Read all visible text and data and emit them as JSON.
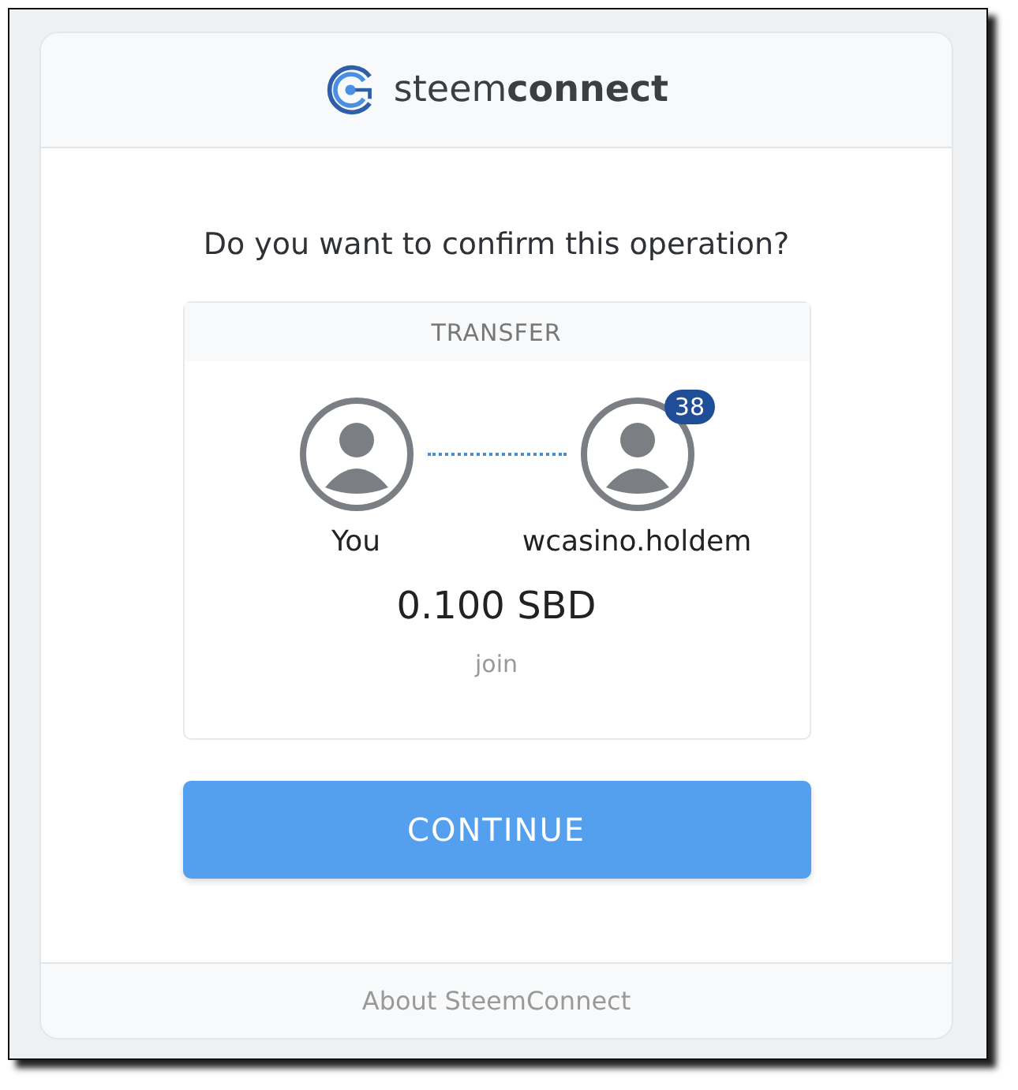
{
  "header": {
    "brand": "steem**connect**"
  },
  "question": "Do you want to confirm this operation?",
  "operation": {
    "title": "TRANSFER",
    "from": {
      "name": "You"
    },
    "to": {
      "name": "wcasino.holdem",
      "badge": "38"
    },
    "amount": "0.100 SBD",
    "memo": "join"
  },
  "button": "CONTINUE",
  "footer": {
    "link": "About SteemConnect"
  }
}
